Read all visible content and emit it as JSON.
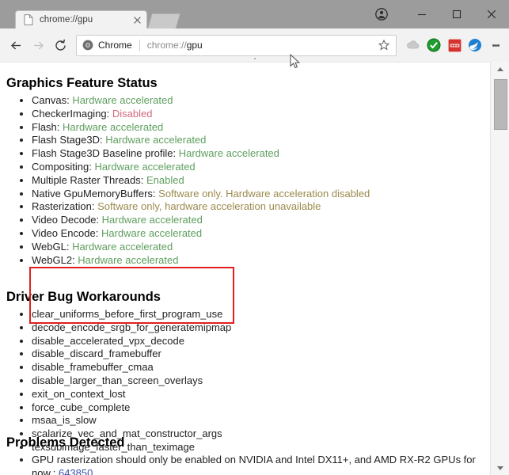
{
  "window": {
    "controls": {
      "minimize": "minimize-icon",
      "maximize": "maximize-icon",
      "close": "close-icon",
      "profile": "profile-avatar-icon"
    }
  },
  "tabstrip": {
    "tabs": [
      {
        "title": "chrome://gpu",
        "favicon": "page-icon",
        "close": "close-icon"
      }
    ],
    "new_tab_label": ""
  },
  "toolbar": {
    "back": "back-arrow-icon",
    "forward": "forward-arrow-icon",
    "reload": "reload-icon",
    "badge_label": "Chrome",
    "url_prefix": "chrome://",
    "url_emphasis": "gpu",
    "bookmark": "star-icon",
    "extensions": [
      "cloud-icon",
      "green-check-icon",
      "red-dots-icon",
      "blue-bird-icon"
    ],
    "menu": "three-dot-menu-icon"
  },
  "page": {
    "sections": [
      {
        "heading": "Graphics Feature Status",
        "items": [
          {
            "key": "Canvas: ",
            "value": "Hardware accelerated",
            "status": "green"
          },
          {
            "key": "CheckerImaging: ",
            "value": "Disabled",
            "status": "red"
          },
          {
            "key": "Flash: ",
            "value": "Hardware accelerated",
            "status": "green"
          },
          {
            "key": "Flash Stage3D: ",
            "value": "Hardware accelerated",
            "status": "green"
          },
          {
            "key": "Flash Stage3D Baseline profile: ",
            "value": "Hardware accelerated",
            "status": "green"
          },
          {
            "key": "Compositing: ",
            "value": "Hardware accelerated",
            "status": "green"
          },
          {
            "key": "Multiple Raster Threads: ",
            "value": "Enabled",
            "status": "green"
          },
          {
            "key": "Native GpuMemoryBuffers: ",
            "value": "Software only. Hardware acceleration disabled",
            "status": "orange"
          },
          {
            "key": "Rasterization: ",
            "value": "Software only, hardware acceleration unavailable",
            "status": "orange"
          },
          {
            "key": "Video Decode: ",
            "value": "Hardware accelerated",
            "status": "green"
          },
          {
            "key": "Video Encode: ",
            "value": "Hardware accelerated",
            "status": "green"
          },
          {
            "key": "WebGL: ",
            "value": "Hardware accelerated",
            "status": "green"
          },
          {
            "key": "WebGL2: ",
            "value": "Hardware accelerated",
            "status": "green"
          }
        ]
      },
      {
        "heading": "Driver Bug Workarounds",
        "items": [
          {
            "key": "clear_uniforms_before_first_program_use",
            "value": "",
            "status": "plain"
          },
          {
            "key": "decode_encode_srgb_for_generatemipmap",
            "value": "",
            "status": "plain"
          },
          {
            "key": "disable_accelerated_vpx_decode",
            "value": "",
            "status": "plain"
          },
          {
            "key": "disable_discard_framebuffer",
            "value": "",
            "status": "plain"
          },
          {
            "key": "disable_framebuffer_cmaa",
            "value": "",
            "status": "plain"
          },
          {
            "key": "disable_larger_than_screen_overlays",
            "value": "",
            "status": "plain"
          },
          {
            "key": "exit_on_context_lost",
            "value": "",
            "status": "plain"
          },
          {
            "key": "force_cube_complete",
            "value": "",
            "status": "plain"
          },
          {
            "key": "msaa_is_slow",
            "value": "",
            "status": "plain"
          },
          {
            "key": "scalarize_vec_and_mat_constructor_args",
            "value": "",
            "status": "plain"
          },
          {
            "key": "texsubimage_faster_than_teximage",
            "value": "",
            "status": "plain"
          }
        ]
      },
      {
        "heading": "Problems Detected",
        "problem": {
          "text": "GPU rasterization should only be enabled on NVIDIA and Intel DX11+, and AMD RX-R2 GPUs for now.: ",
          "link": "643850"
        }
      }
    ]
  },
  "annotation": {
    "highlight_color": "#e02020"
  },
  "colors": {
    "green": "#5e9e5e",
    "red": "#d4697c",
    "orange": "#9b8a4c",
    "link": "#3b55a8"
  },
  "scrollbar": {
    "up": "scroll-up-arrow-icon",
    "down": "scroll-down-arrow-icon",
    "thumb": "scroll-thumb"
  }
}
